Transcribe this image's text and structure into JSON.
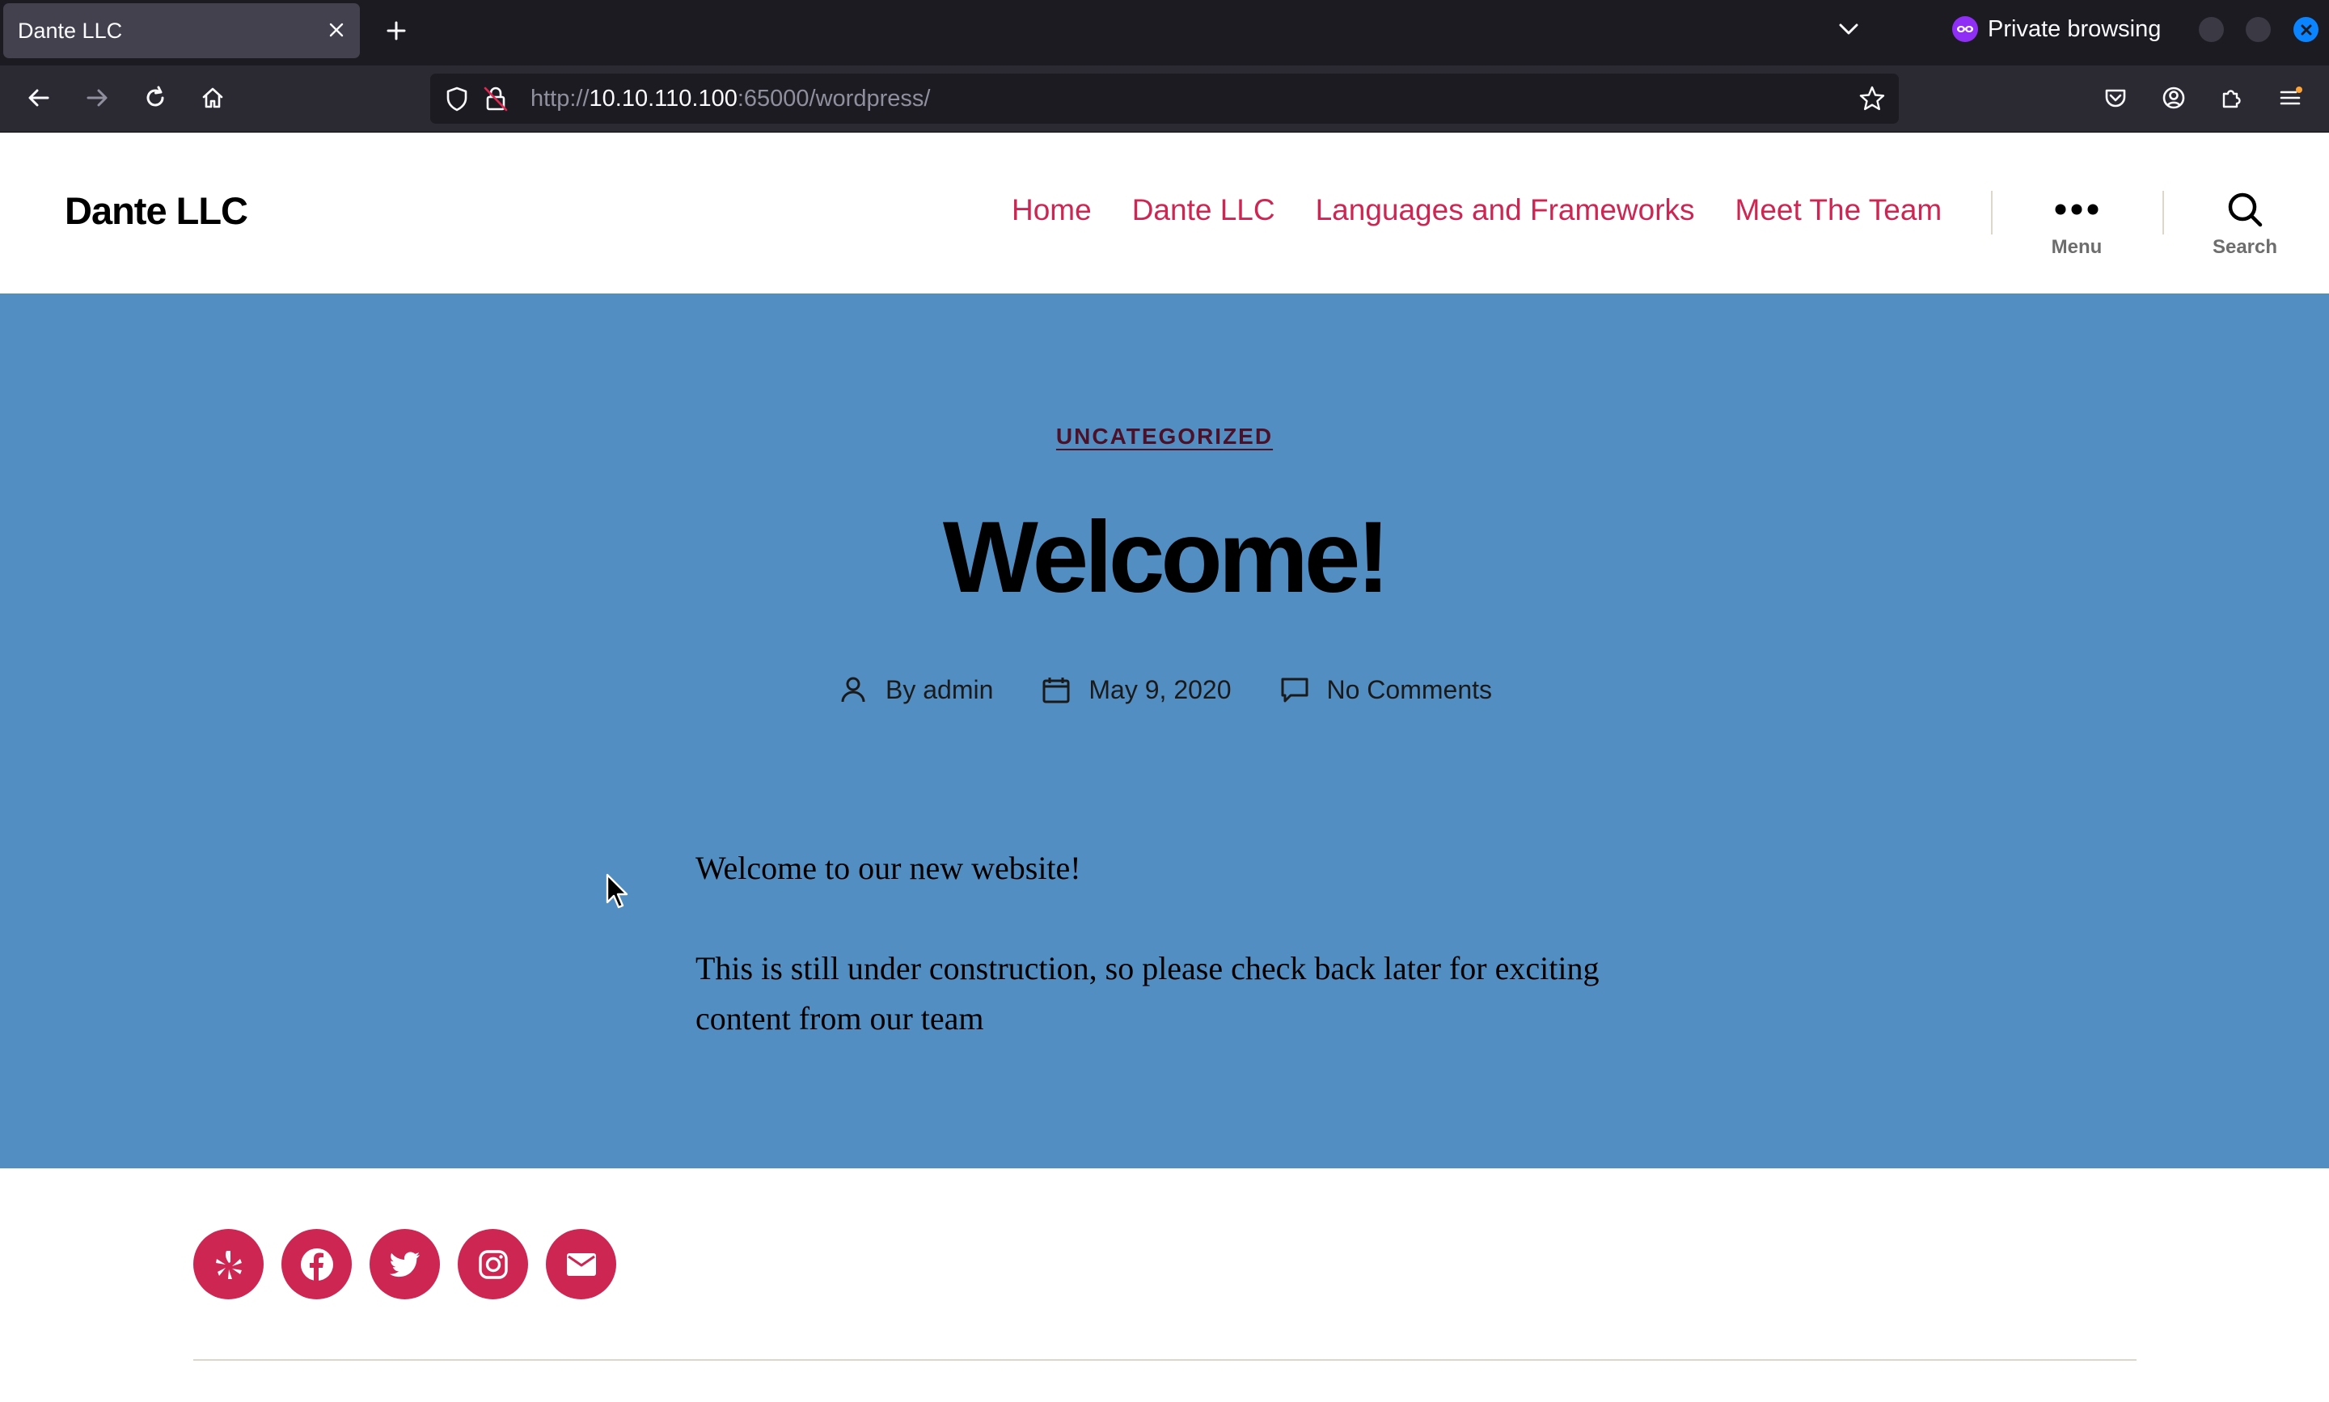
{
  "browser": {
    "tab_title": "Dante LLC",
    "private_label": "Private browsing",
    "url_scheme": "http://",
    "url_host": "10.10.110.100",
    "url_rest": ":65000/wordpress/"
  },
  "site": {
    "title": "Dante LLC",
    "nav": [
      "Home",
      "Dante LLC",
      "Languages and Frameworks",
      "Meet The Team"
    ],
    "menu_label": "Menu",
    "search_label": "Search"
  },
  "post": {
    "category": "UNCATEGORIZED",
    "title": "Welcome!",
    "author": "By admin",
    "date": "May 9, 2020",
    "comments": "No Comments",
    "paragraphs": [
      "Welcome to our new website!",
      "This is still under construction, so please check back later for exciting content from our team"
    ]
  },
  "footer": {
    "social_icons": [
      "yelp-icon",
      "facebook-icon",
      "twitter-icon",
      "instagram-icon",
      "mail-icon"
    ]
  },
  "colors": {
    "accent": "#cd2653",
    "hero_bg": "#538ec2",
    "category": "#4a1128",
    "chrome_dark": "#1c1b22",
    "chrome_toolbar": "#2b2a33"
  }
}
